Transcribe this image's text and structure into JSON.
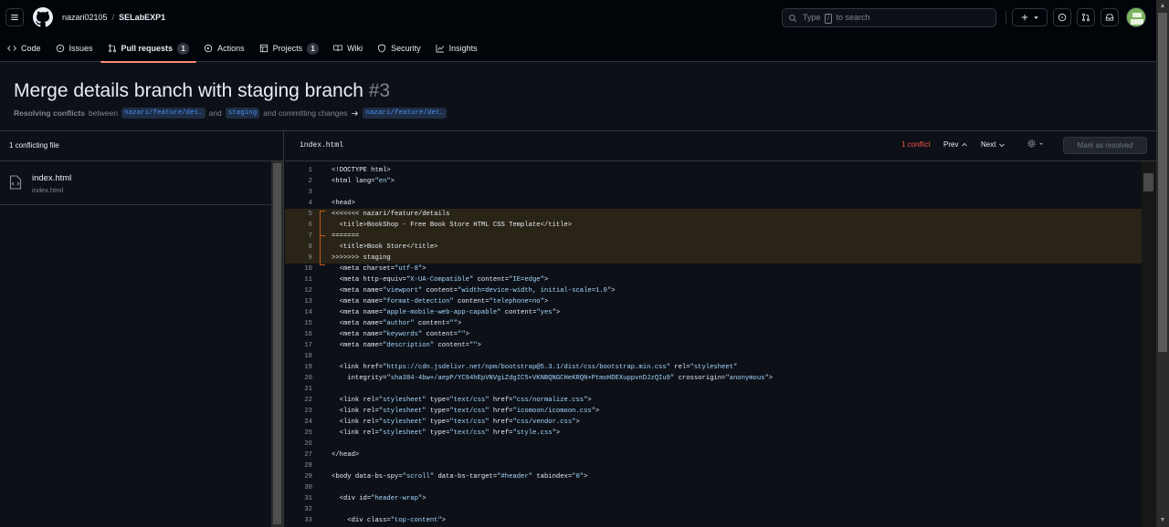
{
  "header": {
    "owner": "nazari02105",
    "separator": "/",
    "repo": "SELabEXP1",
    "search_prefix": "Type",
    "search_key": "/",
    "search_suffix": "to search"
  },
  "nav": {
    "code": "Code",
    "issues": "Issues",
    "pull_requests": "Pull requests",
    "pull_requests_count": "1",
    "actions": "Actions",
    "projects": "Projects",
    "projects_count": "1",
    "wiki": "Wiki",
    "security": "Security",
    "insights": "Insights"
  },
  "pr": {
    "title": "Merge details branch with staging branch",
    "number": "#3",
    "resolving": "Resolving conflicts",
    "between": "between",
    "branch_head": "nazari/feature/det…",
    "and": "and",
    "branch_base": "staging",
    "committing": "and committing changes",
    "target_branch": "nazari/feature/det…"
  },
  "sidebar": {
    "conflicting_count": "1 conflicting file",
    "file_name": "index.html",
    "file_path": "index.html"
  },
  "editor": {
    "file": "index.html",
    "conflict_count": "1 conflict",
    "prev": "Prev",
    "next": "Next",
    "mark_resolved": "Mark as resolved"
  },
  "code_lines": [
    {
      "n": "1",
      "t": "<!DOCTYPE html>"
    },
    {
      "n": "2",
      "t": "<html lang=\"en\">"
    },
    {
      "n": "3",
      "t": ""
    },
    {
      "n": "4",
      "t": "<head>"
    },
    {
      "n": "5",
      "t": "<<<<<<< nazari/feature/details",
      "c": true
    },
    {
      "n": "6",
      "t": "  <title>BookShop - Free Book Store HTML CSS Template</title>",
      "c": true
    },
    {
      "n": "7",
      "t": "=======",
      "c": true
    },
    {
      "n": "8",
      "t": "  <title>Book Store</title>",
      "c": true
    },
    {
      "n": "9",
      "t": ">>>>>>> staging",
      "c": true
    },
    {
      "n": "10",
      "t": "  <meta charset=\"utf-8\">"
    },
    {
      "n": "11",
      "t": "  <meta http-equiv=\"X-UA-Compatible\" content=\"IE=edge\">"
    },
    {
      "n": "12",
      "t": "  <meta name=\"viewport\" content=\"width=device-width, initial-scale=1.0\">"
    },
    {
      "n": "13",
      "t": "  <meta name=\"format-detection\" content=\"telephone=no\">"
    },
    {
      "n": "14",
      "t": "  <meta name=\"apple-mobile-web-app-capable\" content=\"yes\">"
    },
    {
      "n": "15",
      "t": "  <meta name=\"author\" content=\"\">"
    },
    {
      "n": "16",
      "t": "  <meta name=\"keywords\" content=\"\">"
    },
    {
      "n": "17",
      "t": "  <meta name=\"description\" content=\"\">"
    },
    {
      "n": "18",
      "t": ""
    },
    {
      "n": "19",
      "t": "  <link href=\"https://cdn.jsdelivr.net/npm/bootstrap@5.3.1/dist/css/bootstrap.min.css\" rel=\"stylesheet\""
    },
    {
      "n": "20",
      "t": "    integrity=\"sha384-4bw+/aepP/YC94hEpVNVgiZdgIC5+VKNBQNGCHeKRQN+PtmoHDEXuppvnDJzQIu9\" crossorigin=\"anonymous\">"
    },
    {
      "n": "21",
      "t": ""
    },
    {
      "n": "22",
      "t": "  <link rel=\"stylesheet\" type=\"text/css\" href=\"css/normalize.css\">"
    },
    {
      "n": "23",
      "t": "  <link rel=\"stylesheet\" type=\"text/css\" href=\"icomoon/icomoon.css\">"
    },
    {
      "n": "24",
      "t": "  <link rel=\"stylesheet\" type=\"text/css\" href=\"css/vendor.css\">"
    },
    {
      "n": "25",
      "t": "  <link rel=\"stylesheet\" type=\"text/css\" href=\"style.css\">"
    },
    {
      "n": "26",
      "t": ""
    },
    {
      "n": "27",
      "t": "</head>"
    },
    {
      "n": "28",
      "t": ""
    },
    {
      "n": "29",
      "t": "<body data-bs-spy=\"scroll\" data-bs-target=\"#header\" tabindex=\"0\">"
    },
    {
      "n": "30",
      "t": ""
    },
    {
      "n": "31",
      "t": "  <div id=\"header-wrap\">"
    },
    {
      "n": "32",
      "t": ""
    },
    {
      "n": "33",
      "t": "    <div class=\"top-content\">"
    }
  ],
  "colors": {
    "accent_underline": "#fd8c73",
    "conflict_text": "#f85149",
    "branch_link": "#4493f8",
    "string": "#a5d6ff"
  }
}
